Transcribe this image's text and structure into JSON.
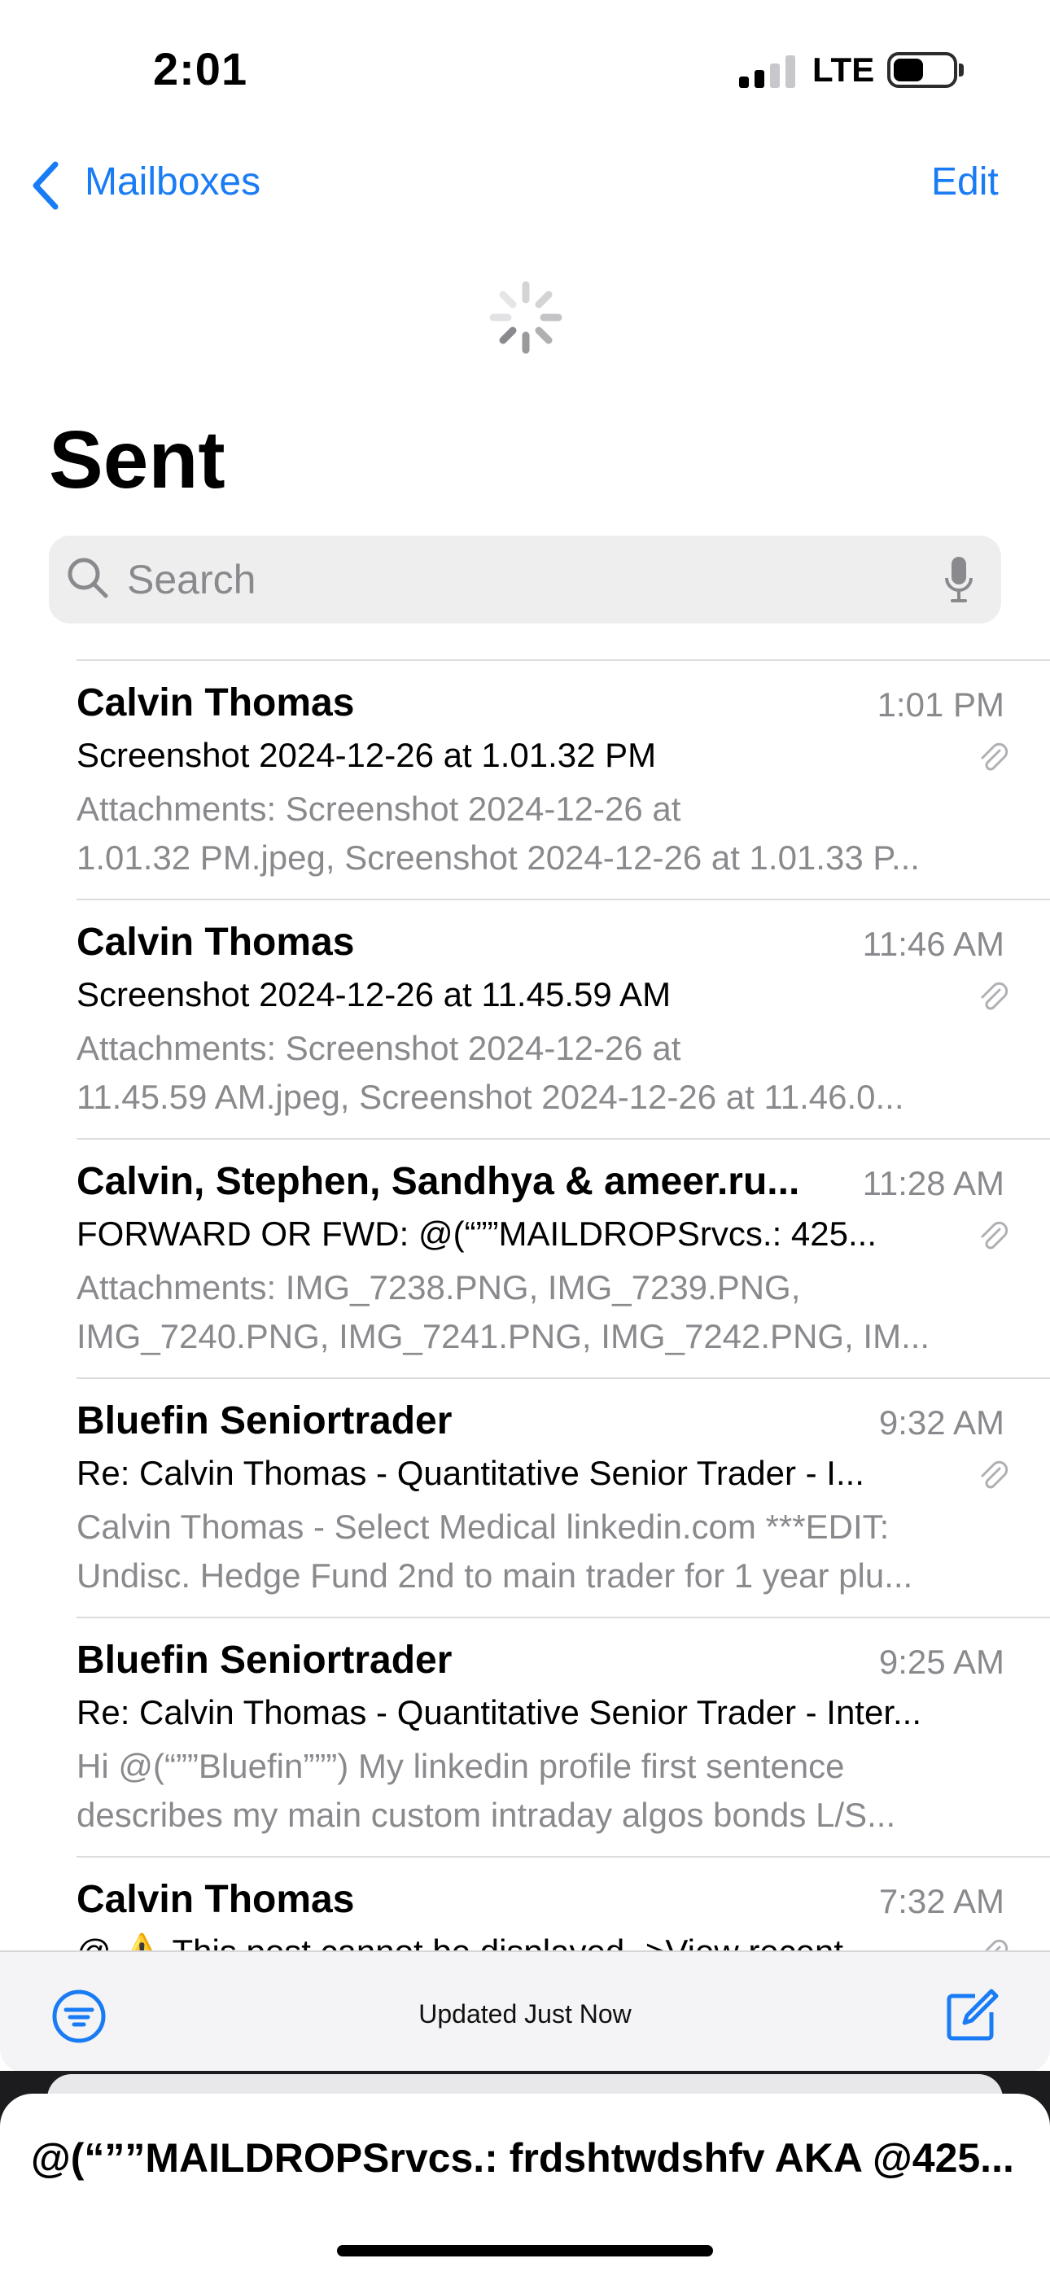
{
  "status_bar": {
    "time": "2:01",
    "network": "LTE"
  },
  "nav": {
    "back_label": "Mailboxes",
    "edit_label": "Edit"
  },
  "page": {
    "title": "Sent"
  },
  "search": {
    "placeholder": "Search"
  },
  "messages": [
    {
      "sender": "Calvin Thomas",
      "time": "1:01 PM",
      "subject": "Screenshot 2024-12-26 at 1.01.32 PM",
      "preview_line1": "Attachments: Screenshot 2024-12-26 at",
      "preview_line2": "1.01.32 PM.jpeg, Screenshot 2024-12-26 at 1.01.33 P...",
      "has_attachment": true
    },
    {
      "sender": "Calvin Thomas",
      "time": "11:46 AM",
      "subject": "Screenshot 2024-12-26 at 11.45.59 AM",
      "preview_line1": "Attachments: Screenshot 2024-12-26 at",
      "preview_line2": "11.45.59 AM.jpeg, Screenshot 2024-12-26 at 11.46.0...",
      "has_attachment": true
    },
    {
      "sender": "Calvin, Stephen, Sandhya & ameer.ru...",
      "time": "11:28 AM",
      "subject": "FORWARD OR FWD: @(“””MAILDROPSrvcs.: 425...",
      "preview_line1": "Attachments: IMG_7238.PNG, IMG_7239.PNG,",
      "preview_line2": "IMG_7240.PNG, IMG_7241.PNG, IMG_7242.PNG, IM...",
      "has_attachment": true
    },
    {
      "sender": "Bluefin Seniortrader",
      "time": "9:32 AM",
      "subject": "Re: Calvin Thomas - Quantitative Senior Trader - I...",
      "preview_line1": "Calvin Thomas - Select Medical linkedin.com ***EDIT:",
      "preview_line2": "Undisc. Hedge Fund 2nd to main trader for 1 year plu...",
      "has_attachment": true
    },
    {
      "sender": "Bluefin Seniortrader",
      "time": "9:25 AM",
      "subject": "Re: Calvin Thomas - Quantitative Senior Trader - Inter...",
      "preview_line1": "Hi @(“””Bluefin”””) My linkedin profile first sentence",
      "preview_line2": "describes my main custom intraday algos bonds L/S...",
      "has_attachment": false
    },
    {
      "sender": "Calvin Thomas",
      "time": "7:32 AM",
      "subject": "@ ⚠️ This post cannot be displayed ->View recent...",
      "preview_line1": "",
      "preview_line2": "",
      "has_attachment": true
    }
  ],
  "toolbar": {
    "status": "Updated Just Now"
  },
  "draft": {
    "title": "@(“””MAILDROPSrvcs.: frdshtwdshfv AKA @425..."
  },
  "colors": {
    "accent": "#1a7cf5",
    "secondary_text": "#8a8a8e"
  },
  "icons": {
    "back": "chevron-left-icon",
    "search": "magnifier-icon",
    "mic": "microphone-icon",
    "attachment": "paperclip-icon",
    "filter": "filter-icon",
    "compose": "compose-icon"
  }
}
